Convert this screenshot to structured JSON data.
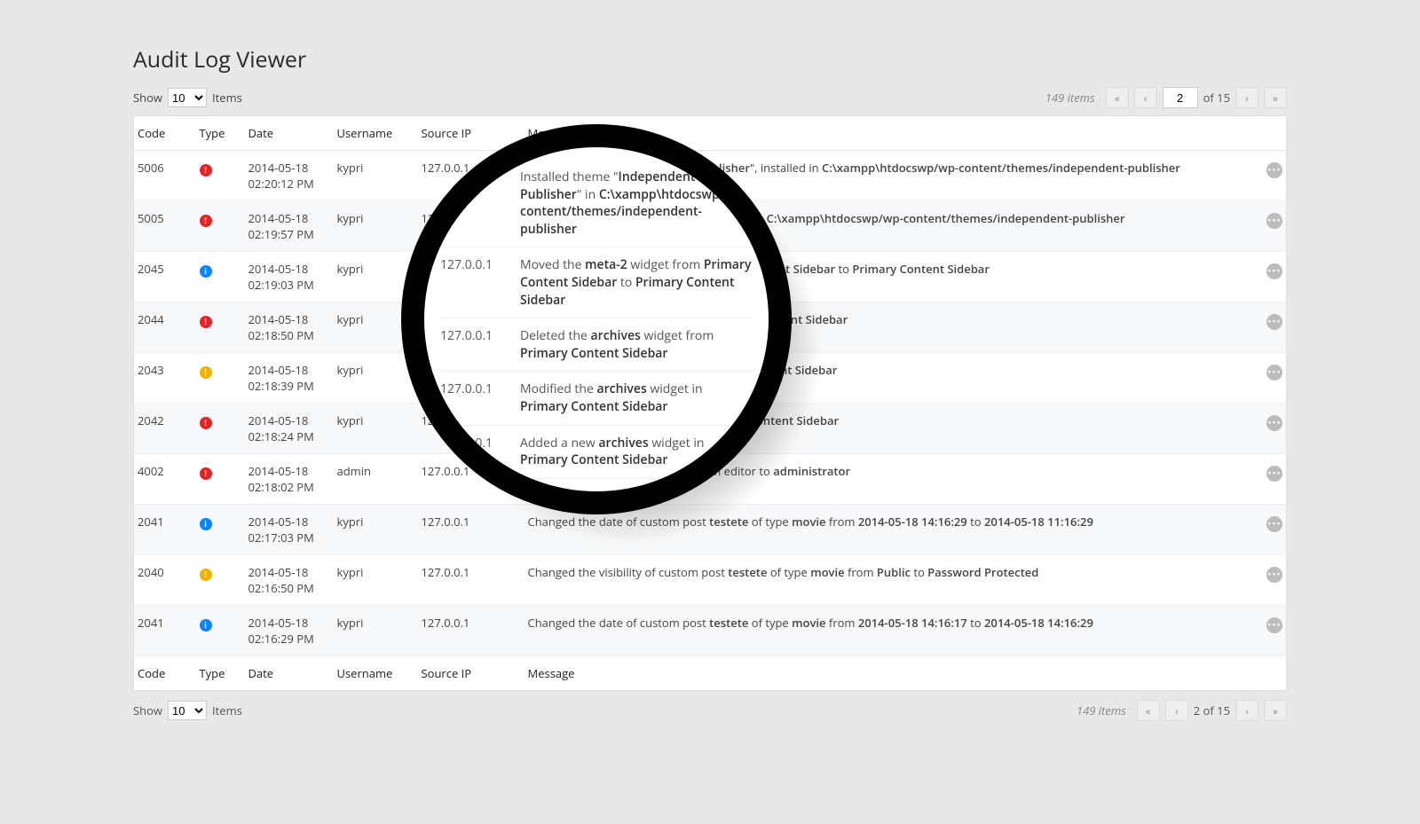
{
  "title": "Audit Log Viewer",
  "show_label": "Show",
  "items_label": "Items",
  "per_page": "10",
  "total_items_text": "149 items",
  "page_input": "2",
  "page_of_text": "of 15",
  "page_of_text_bottom": "2 of 15",
  "columns": {
    "code": "Code",
    "type": "Type",
    "date": "Date",
    "user": "Username",
    "ip": "Source IP",
    "msg": "Message"
  },
  "rows": [
    {
      "code": "5006",
      "type": "red",
      "date_l1": "2014-05-18",
      "date_l2": "02:20:12 PM",
      "user": "kypri",
      "ip": "127.0.0.1",
      "msg": "Activated theme \"<b>Independent Publisher</b>\", installed in <b>C:\\xampp\\htdocswp/wp-content/themes/independent-publisher</b>"
    },
    {
      "code": "5005",
      "type": "red",
      "date_l1": "2014-05-18",
      "date_l2": "02:19:57 PM",
      "user": "kypri",
      "ip": "127.0.0.1",
      "msg": "Installed theme \"<b>Independent Publisher</b>\" in <b>C:\\xampp\\htdocswp/wp-content/themes/independent-publisher</b>"
    },
    {
      "code": "2045",
      "type": "blue",
      "date_l1": "2014-05-18",
      "date_l2": "02:19:03 PM",
      "user": "kypri",
      "ip": "127.0.0.1",
      "msg": "Moved the <b>meta-2</b> widget from <b>Primary Content Sidebar</b> to <b>Primary Content Sidebar</b>"
    },
    {
      "code": "2044",
      "type": "red",
      "date_l1": "2014-05-18",
      "date_l2": "02:18:50 PM",
      "user": "kypri",
      "ip": "127.0.0.1",
      "msg": "Deleted the <b>archives</b> widget from <b>Primary Content Sidebar</b>"
    },
    {
      "code": "2043",
      "type": "orange",
      "date_l1": "2014-05-18",
      "date_l2": "02:18:39 PM",
      "user": "kypri",
      "ip": "127.0.0.1",
      "msg": "Modified the <b>archives</b> widget in <b>Primary Content Sidebar</b>"
    },
    {
      "code": "2042",
      "type": "red",
      "date_l1": "2014-05-18",
      "date_l2": "02:18:24 PM",
      "user": "kypri",
      "ip": "127.0.0.1",
      "msg": "Added a new <b>archives</b> widget in <b>Primary Content Sidebar</b>"
    },
    {
      "code": "4002",
      "type": "red",
      "date_l1": "2014-05-18",
      "date_l2": "02:18:02 PM",
      "user": "admin",
      "ip": "127.0.0.1",
      "msg": "Changed the role of user <b>kypri</b> from editor to <b>administrator</b>"
    },
    {
      "code": "2041",
      "type": "blue",
      "date_l1": "2014-05-18",
      "date_l2": "02:17:03 PM",
      "user": "kypri",
      "ip": "127.0.0.1",
      "msg": "Changed the date of custom post <b>testete</b> of type <b>movie</b> from <b>2014-05-18 14:16:29</b> to <b>2014-05-18 11:16:29</b>"
    },
    {
      "code": "2040",
      "type": "orange",
      "date_l1": "2014-05-18",
      "date_l2": "02:16:50 PM",
      "user": "kypri",
      "ip": "127.0.0.1",
      "msg": "Changed the visibility of custom post <b>testete</b> of type <b>movie</b> from <b>Public</b> to <b>Password Protected</b>"
    },
    {
      "code": "2041",
      "type": "blue",
      "date_l1": "2014-05-18",
      "date_l2": "02:16:29 PM",
      "user": "kypri",
      "ip": "127.0.0.1",
      "msg": "Changed the date of custom post <b>testete</b> of type <b>movie</b> from <b>2014-05-18 14:16:17</b> to <b>2014-05-18 14:16:29</b>"
    }
  ],
  "magnifier": [
    {
      "ip": "",
      "msg": "Installed theme \"<b>Independent Publisher</b>\" in <b>C:\\xampp\\htdocswp/wp-content/themes/independent-publisher</b>"
    },
    {
      "ip": "127.0.0.1",
      "msg": "Moved the <b>meta-2</b> widget from <b>Primary Content Sidebar</b> to <b>Primary Content Sidebar</b>"
    },
    {
      "ip": "127.0.0.1",
      "msg": "Deleted the <b>archives</b> widget from <b>Primary Content Sidebar</b>"
    },
    {
      "ip": "127.0.0.1",
      "msg": "Modified the <b>archives</b> widget in <b>Primary Content Sidebar</b>"
    },
    {
      "ip": "127.0.0.1",
      "msg": "Added a new <b>archives</b> widget in <b>Primary Content Sidebar</b>"
    },
    {
      "ip": "127.0.0.1",
      "msg": "Changed the role of user <b>kypri</b> from editor to <b>administrator</b>"
    }
  ]
}
